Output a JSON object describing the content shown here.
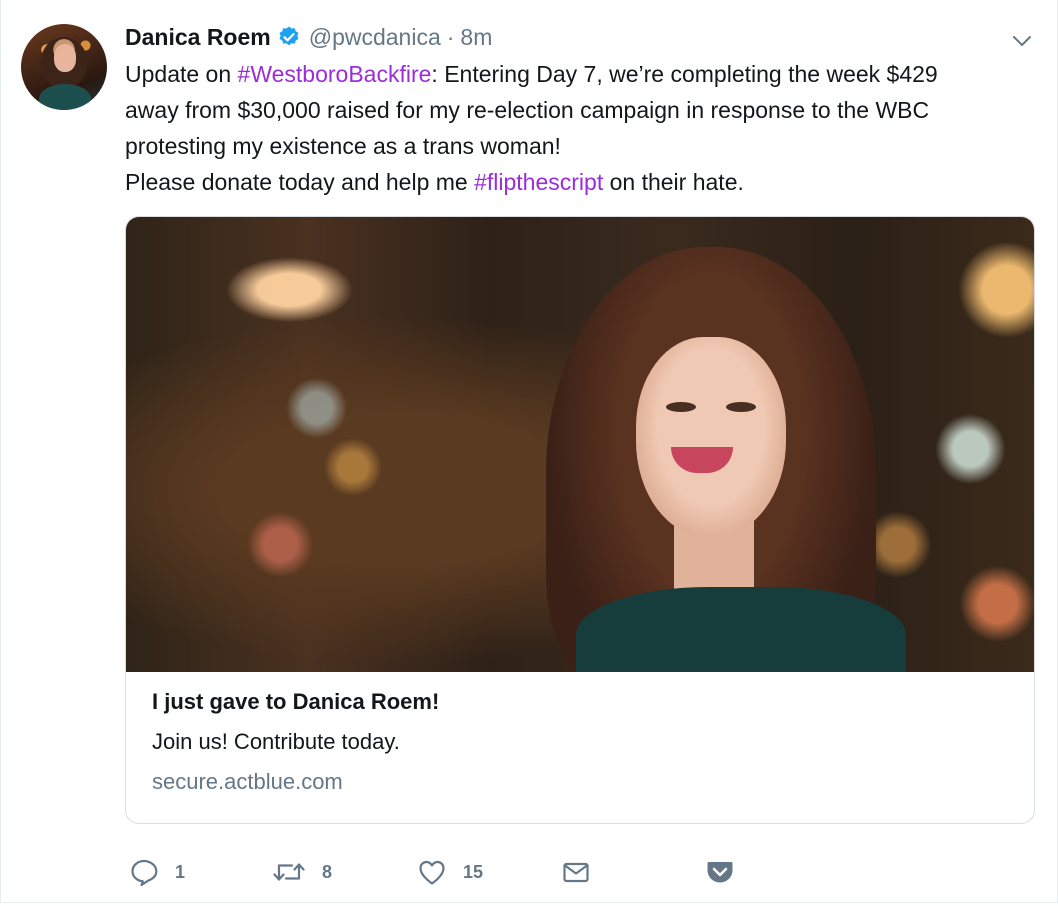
{
  "tweet": {
    "author_name": "Danica Roem",
    "handle": "@pwcdanica",
    "separator": "·",
    "time": "8m",
    "text_lines": [
      {
        "pre": "Update on ",
        "hashtag": "#WestboroBackfire",
        "post": ": Entering Day 7, we’re completing the week $429"
      },
      {
        "pre": "away from $30,000 raised for my re-election campaign in response to the WBC"
      },
      {
        "pre": "protesting my existence as a trans woman!"
      },
      {
        "pre": "Please donate today and help me ",
        "hashtag": "#flipthescript",
        "post": " on their hate."
      }
    ]
  },
  "card": {
    "title": "I just gave to Danica Roem!",
    "description": "Join us! Contribute today.",
    "domain": "secure.actblue.com"
  },
  "actions": {
    "reply_count": "1",
    "retweet_count": "8",
    "like_count": "15"
  },
  "colors": {
    "hashtag": "#9a2cd9",
    "secondary_text": "#657786",
    "verified_badge": "#1da1f2"
  },
  "icons": [
    "verified-badge-icon",
    "chevron-down-icon",
    "reply-icon",
    "retweet-icon",
    "heart-icon",
    "envelope-icon",
    "pocket-icon"
  ]
}
